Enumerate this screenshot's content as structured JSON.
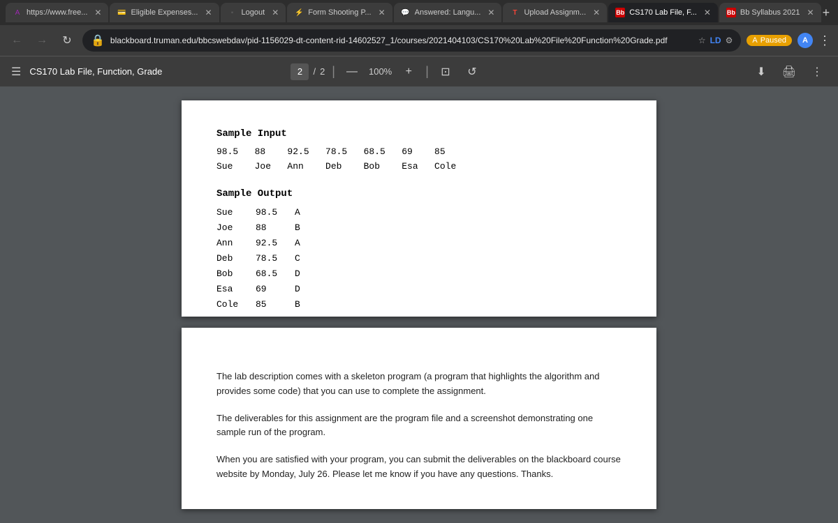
{
  "tabs": [
    {
      "id": "tab1",
      "favicon": "A",
      "label": "https://www.free...",
      "active": false,
      "favicon_type": "text",
      "favicon_color": "#9c27b0"
    },
    {
      "id": "tab2",
      "favicon": "💳",
      "label": "Eligible Expenses...",
      "active": false,
      "favicon_type": "emoji"
    },
    {
      "id": "tab3",
      "favicon": "▪",
      "label": "Logout",
      "active": false,
      "favicon_type": "text",
      "favicon_color": "#555"
    },
    {
      "id": "tab4",
      "favicon": "⚡",
      "label": "Form Shooting P...",
      "active": false,
      "favicon_type": "emoji"
    },
    {
      "id": "tab5",
      "favicon": "💬",
      "label": "Answered: Langu...",
      "active": false,
      "favicon_type": "emoji"
    },
    {
      "id": "tab6",
      "favicon": "T",
      "label": "Upload Assignm...",
      "active": false,
      "favicon_type": "text",
      "favicon_color": "#cc0000"
    },
    {
      "id": "tab7",
      "favicon": "Bb",
      "label": "CS170 Lab File, F...",
      "active": true,
      "favicon_type": "bb"
    },
    {
      "id": "tab8",
      "favicon": "Bb",
      "label": "Bb Syllabus 2021",
      "active": false,
      "favicon_type": "bb"
    }
  ],
  "address_bar": {
    "url": "blackboard.truman.edu/bbcswebdav/pid-1156029-dt-content-rid-14602527_1/courses/2021404103/CS170%20Lab%20File%20Function%20Grade.pdf",
    "lock_icon": "🔒",
    "paused_label": "Paused"
  },
  "toolbar": {
    "title": "CS170 Lab File, Function, Grade",
    "hamburger": "☰",
    "page_current": "2",
    "page_total": "2",
    "separator": "/",
    "minus": "—",
    "zoom": "100%",
    "plus": "+",
    "fit_icon": "⊡",
    "rotate_icon": "↺",
    "download_icon": "⬇",
    "print_icon": "🖨",
    "more_icon": "⋮"
  },
  "page1": {
    "sample_input_title": "Sample Input",
    "input_row1": "98.5   88    92.5   78.5   68.5   69    85",
    "input_row2": "Sue    Joe   Ann    Deb    Bob    Esa   Cole",
    "sample_output_title": "Sample Output",
    "output_rows": [
      {
        "name": "Sue",
        "score": "98.5",
        "grade": "A"
      },
      {
        "name": "Joe",
        "score": "88",
        "grade": "B"
      },
      {
        "name": "Ann",
        "score": "92.5",
        "grade": "A"
      },
      {
        "name": "Deb",
        "score": "78.5",
        "grade": "C"
      },
      {
        "name": "Bob",
        "score": "68.5",
        "grade": "D"
      },
      {
        "name": "Esa",
        "score": "69",
        "grade": "D"
      },
      {
        "name": "Cole",
        "score": "85",
        "grade": "B"
      }
    ]
  },
  "page2": {
    "paragraph1": "The lab description comes with a skeleton program (a program that highlights the algorithm and provides some code) that you can use to complete the assignment.",
    "paragraph2": "The deliverables for this assignment are the program file and a screenshot demonstrating one sample run of the program.",
    "paragraph3": "When you are satisfied with your program, you can submit the deliverables on the blackboard course website by Monday, July 26. Please let me know if you have any questions. Thanks."
  }
}
